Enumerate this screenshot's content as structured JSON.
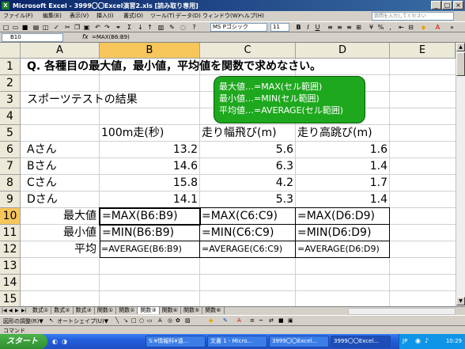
{
  "window": {
    "title": "Microsoft Excel - 3999〇〇Excel演習2.xls [読み取り専用]",
    "app_icon": "excel-icon",
    "buttons": [
      "minimize-icon",
      "maximize-icon",
      "close-icon"
    ]
  },
  "menu": {
    "items": [
      "ファイル(F)",
      "編集(E)",
      "表示(V)",
      "挿入(I)",
      "書式(O)",
      "ツール(T)",
      "データ(D)",
      "ウィンドウ(W)",
      "ヘルプ(H)"
    ],
    "help_placeholder": "質問を入力してください"
  },
  "toolbar": {
    "font_name": "MS Pゴシック",
    "font_size": "11",
    "bold": "B",
    "italic": "I",
    "underline": "U"
  },
  "formula_bar": {
    "name_box": "B10",
    "fx": "fx",
    "formula": "=MAX(B6:B9)"
  },
  "grid": {
    "columns": [
      "A",
      "B",
      "C",
      "D",
      "E"
    ],
    "selected_column": "B",
    "rows": [
      "1",
      "2",
      "3",
      "4",
      "5",
      "6",
      "7",
      "8",
      "9",
      "10",
      "11",
      "12",
      "13",
      "14",
      "15"
    ],
    "selected_row": "10",
    "cells": {
      "A1": "Q. 各種目の最大値，最小値，平均値を関数で求めなさい。",
      "A3": "スポーツテストの結果",
      "B5": "100m走(秒)",
      "C5": "走り幅飛び(m)",
      "D5": "走り高跳び(m)",
      "A6": "Aさん",
      "B6": "13.2",
      "C6": "5.6",
      "D6": "1.6",
      "A7": "Bさん",
      "B7": "14.6",
      "C7": "6.3",
      "D7": "1.4",
      "A8": "Cさん",
      "B8": "15.8",
      "C8": "4.2",
      "D8": "1.7",
      "A9": "Dさん",
      "B9": "14.1",
      "C9": "5.3",
      "D9": "1.4",
      "A10": "最大値",
      "B10": "=MAX(B6:B9)",
      "C10": "=MAX(C6:C9)",
      "D10": "=MAX(D6:D9)",
      "A11": "最小値",
      "B11": "=MIN(B6:B9)",
      "C11": "=MIN(C6:C9)",
      "D11": "=MIN(D6:D9)",
      "A12": "平均",
      "B12": "=AVERAGE(B6:B9)",
      "C12": "=AVERAGE(C6:C9)",
      "D12": "=AVERAGE(D6:D9)"
    }
  },
  "note": {
    "line1": "最大値…=MAX(セル範囲)",
    "line2": "最小値…=MIN(セル範囲)",
    "line3": "平均値…=AVERAGE(セル範囲)",
    "color": "#1ea81e"
  },
  "sheet_tabs": {
    "tabs": [
      "数式①",
      "数式②",
      "数式③",
      "関数①",
      "関数②",
      "関数③",
      "関数④",
      "関数⑤",
      "関数⑥"
    ],
    "active": "関数③"
  },
  "draw_toolbar": {
    "draw_label": "図形の調整(R)▼",
    "autoshape_label": "オートシェイプ(U)▼"
  },
  "status": {
    "text": "コマンド"
  },
  "taskbar": {
    "start_label": "スタート",
    "buttons": [
      "S:¥情報科¥遠...",
      "文書 1 - Micro...",
      "3999〇〇Excel...",
      "3999〇〇Excel..."
    ],
    "ime": "JP",
    "clock": "10:29"
  }
}
